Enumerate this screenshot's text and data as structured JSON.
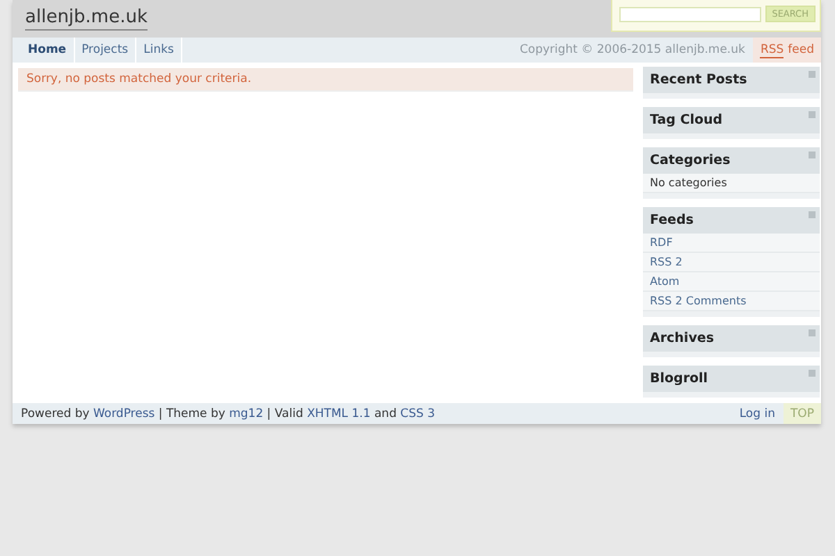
{
  "site_title": "allenjb.me.uk",
  "search": {
    "button": "SEARCH"
  },
  "nav": [
    {
      "label": "Home",
      "selected": true
    },
    {
      "label": "Projects",
      "selected": false
    },
    {
      "label": "Links",
      "selected": false
    }
  ],
  "copyright": "Copyright © 2006-2015 allenjb.me.uk",
  "rss": {
    "abbr": "RSS",
    "label": "feed"
  },
  "notice": "Sorry, no posts matched your criteria.",
  "widgets": [
    {
      "title": "Recent Posts"
    },
    {
      "title": "Tag Cloud"
    },
    {
      "title": "Categories",
      "items": [
        {
          "text": "No categories",
          "kind": "text"
        }
      ]
    },
    {
      "title": "Feeds",
      "items": [
        {
          "text": "RDF",
          "kind": "link"
        },
        {
          "text": "RSS 2",
          "kind": "link"
        },
        {
          "text": "Atom",
          "kind": "link"
        },
        {
          "text": "RSS 2 Comments",
          "kind": "link"
        }
      ]
    },
    {
      "title": "Archives"
    },
    {
      "title": "Blogroll"
    }
  ],
  "footer": {
    "segments": [
      {
        "kind": "text",
        "text": "Powered by "
      },
      {
        "kind": "link",
        "text": "WordPress"
      },
      {
        "kind": "text",
        "text": " | Theme by "
      },
      {
        "kind": "link",
        "text": "mg12"
      },
      {
        "kind": "text",
        "text": " | Valid "
      },
      {
        "kind": "link",
        "text": "XHTML 1.1"
      },
      {
        "kind": "text",
        "text": " and "
      },
      {
        "kind": "link",
        "text": "CSS 3"
      }
    ],
    "login": "Log in",
    "top": "TOP"
  }
}
